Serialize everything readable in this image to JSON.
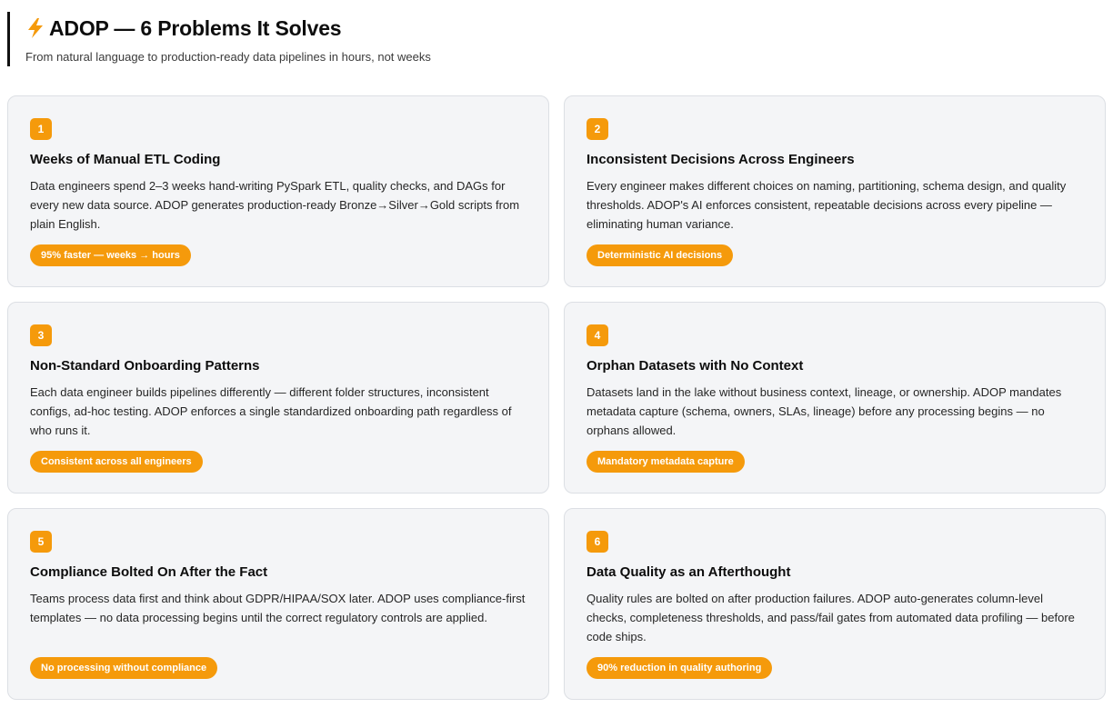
{
  "header": {
    "title": "ADOP — 6 Problems It Solves",
    "subtitle": "From natural language to production-ready data pipelines in hours, not weeks",
    "icon": "lightning-bolt-icon",
    "icon_color": "#f59a0b"
  },
  "accent_color": "#f59a0b",
  "cards": [
    {
      "number": "1",
      "title": "Weeks of Manual ETL Coding",
      "description": "Data engineers spend 2–3 weeks hand-writing PySpark ETL, quality checks, and DAGs for every new data source. ADOP generates production-ready Bronze→Silver→Gold scripts from plain English.",
      "badge": "95% faster — weeks → hours"
    },
    {
      "number": "2",
      "title": "Inconsistent Decisions Across Engineers",
      "description": "Every engineer makes different choices on naming, partitioning, schema design, and quality thresholds. ADOP's AI enforces consistent, repeatable decisions across every pipeline — eliminating human variance.",
      "badge": "Deterministic AI decisions"
    },
    {
      "number": "3",
      "title": "Non-Standard Onboarding Patterns",
      "description": "Each data engineer builds pipelines differently — different folder structures, inconsistent configs, ad-hoc testing. ADOP enforces a single standardized onboarding path regardless of who runs it.",
      "badge": "Consistent across all engineers"
    },
    {
      "number": "4",
      "title": "Orphan Datasets with No Context",
      "description": "Datasets land in the lake without business context, lineage, or ownership. ADOP mandates metadata capture (schema, owners, SLAs, lineage) before any processing begins — no orphans allowed.",
      "badge": "Mandatory metadata capture"
    },
    {
      "number": "5",
      "title": "Compliance Bolted On After the Fact",
      "description": "Teams process data first and think about GDPR/HIPAA/SOX later. ADOP uses compliance-first templates — no data processing begins until the correct regulatory controls are applied.",
      "badge": "No processing without compliance"
    },
    {
      "number": "6",
      "title": "Data Quality as an Afterthought",
      "description": "Quality rules are bolted on after production failures. ADOP auto-generates column-level checks, completeness thresholds, and pass/fail gates from automated data profiling — before code ships.",
      "badge": "90% reduction in quality authoring"
    }
  ]
}
